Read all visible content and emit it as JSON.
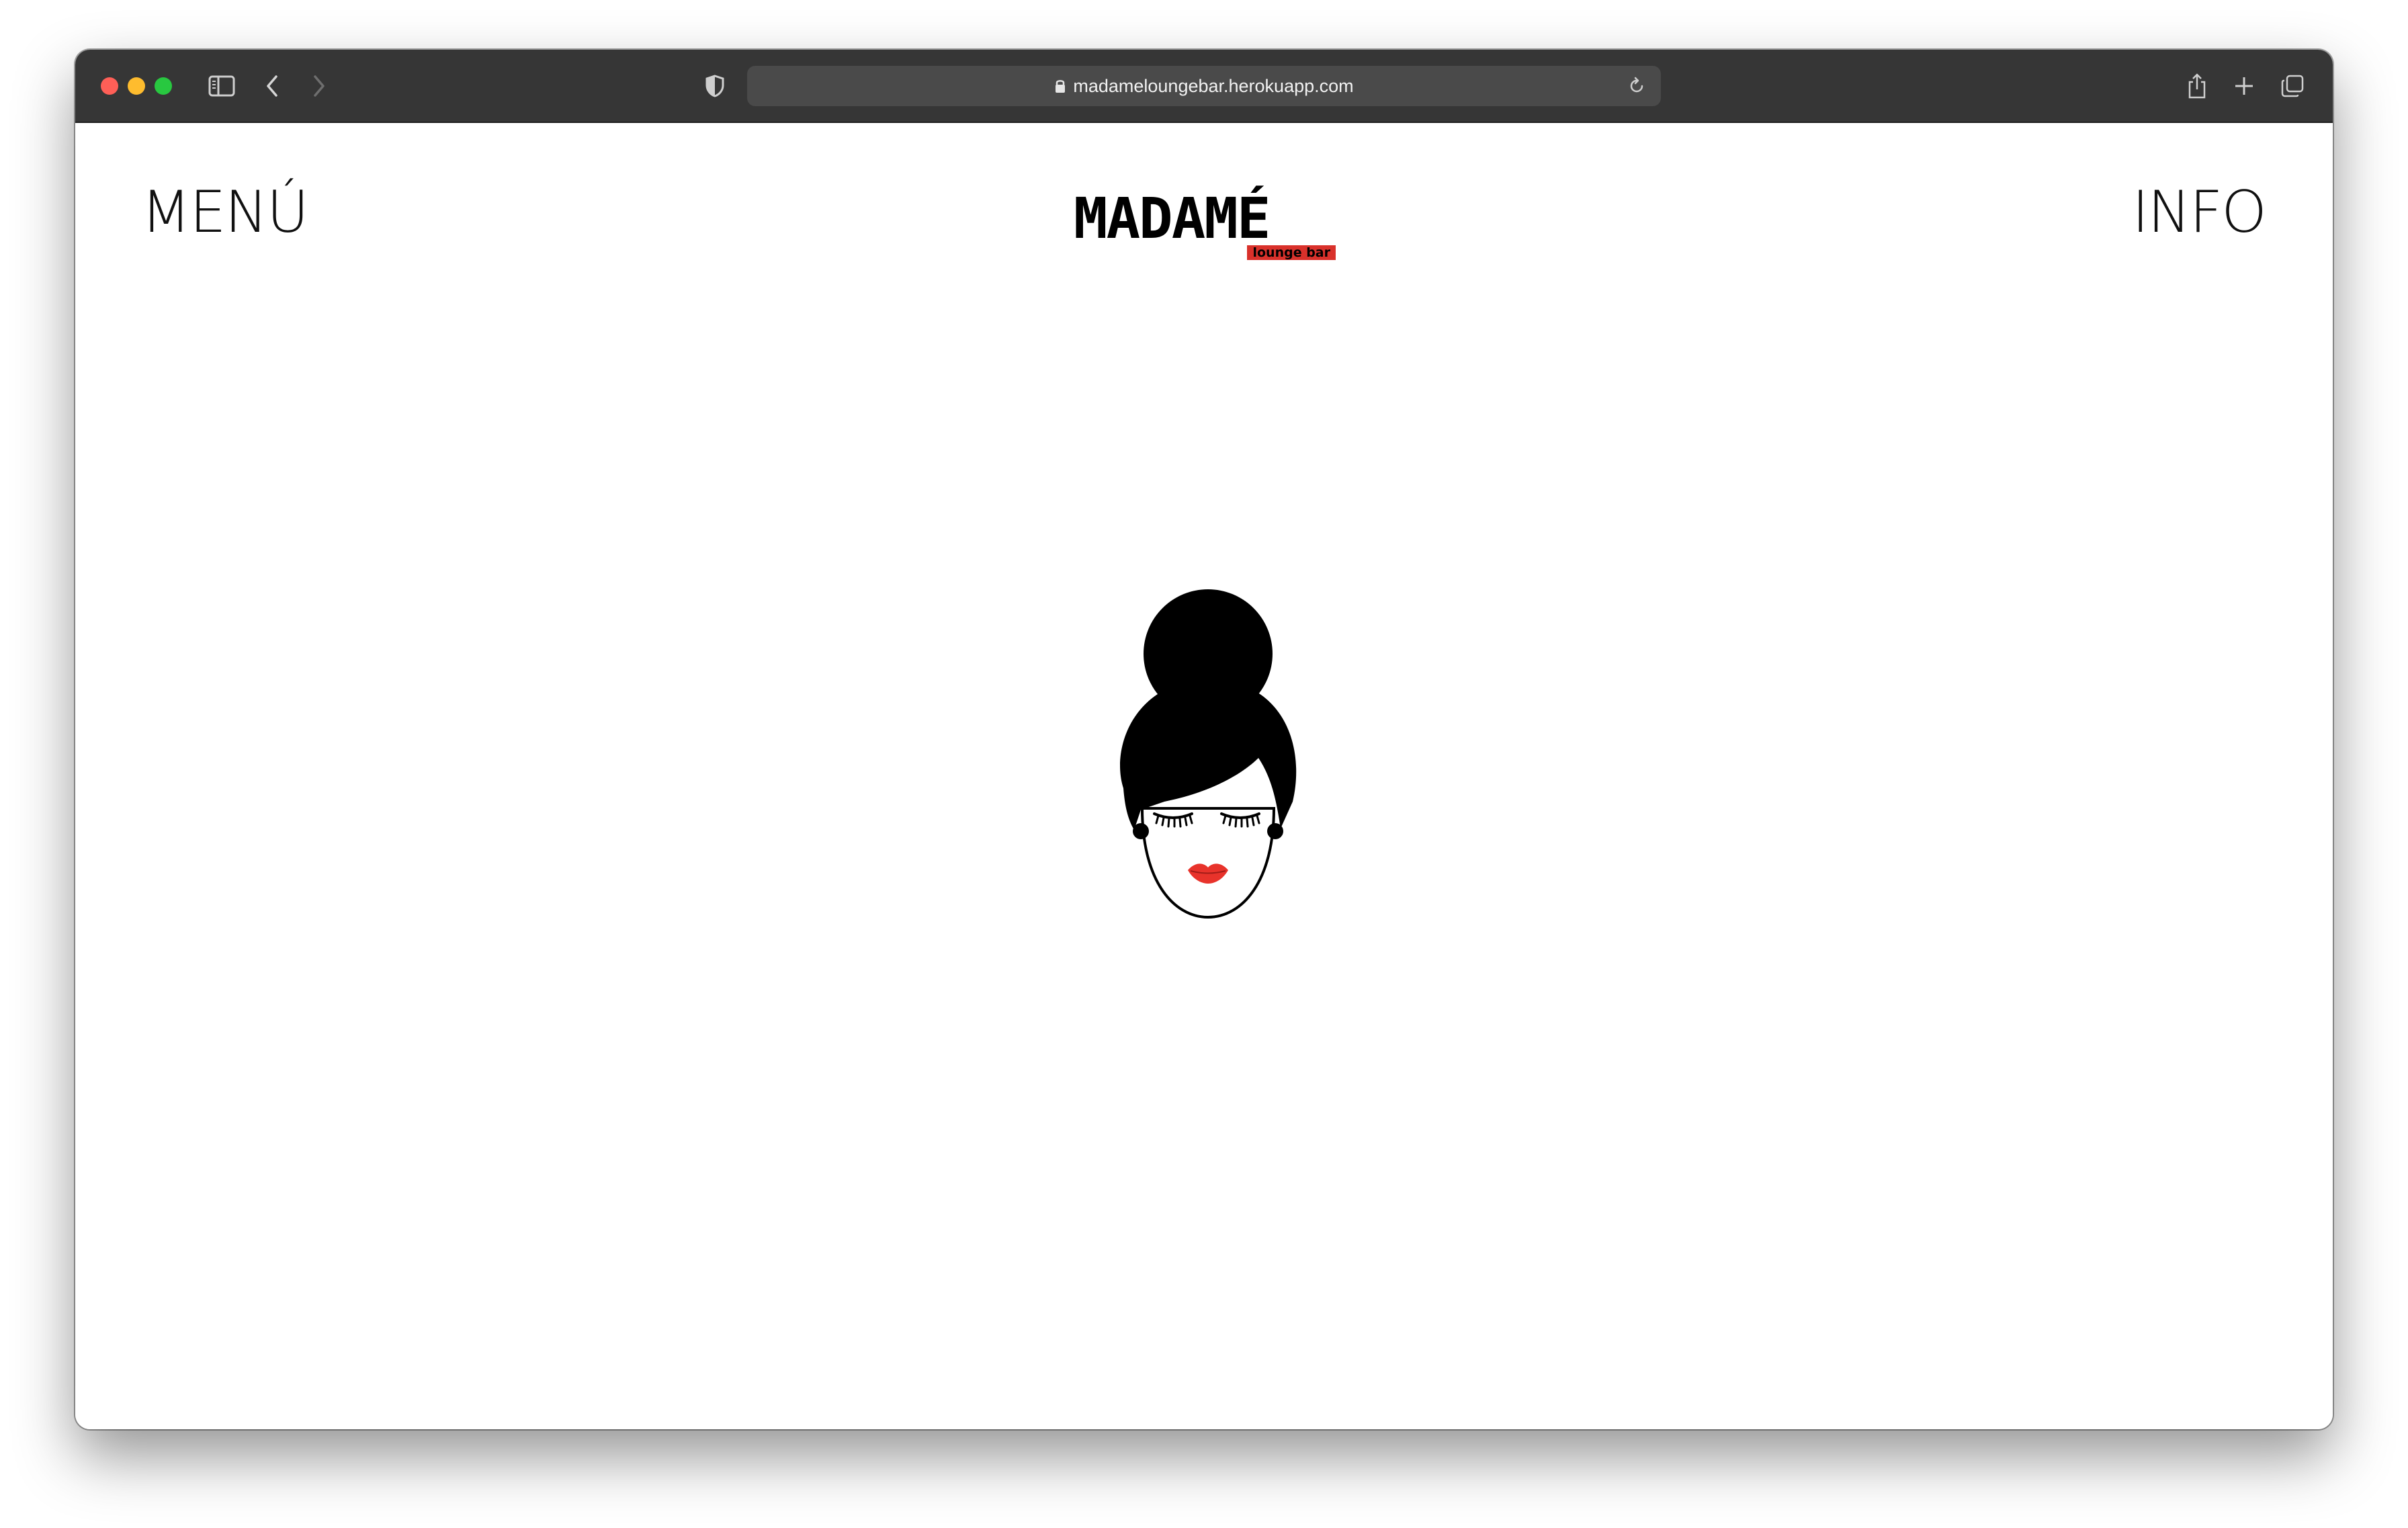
{
  "browser": {
    "url": "madameloungebar.herokuapp.com",
    "icons": {
      "sidebar": "sidebar-icon",
      "back": "chevron-left-icon",
      "forward": "chevron-right-icon",
      "privacy": "shield-icon",
      "lock": "lock-icon",
      "reload": "reload-icon",
      "share": "share-icon",
      "new_tab": "plus-icon",
      "tabs": "tabs-overview-icon"
    }
  },
  "page": {
    "nav": {
      "menu_label": "MENÚ",
      "info_label": "INFO"
    },
    "logo": {
      "name": "MADAMÉ",
      "tagline": "lounge bar"
    },
    "colors": {
      "accent": "#d9312b",
      "text": "#111111",
      "background": "#ffffff"
    }
  }
}
